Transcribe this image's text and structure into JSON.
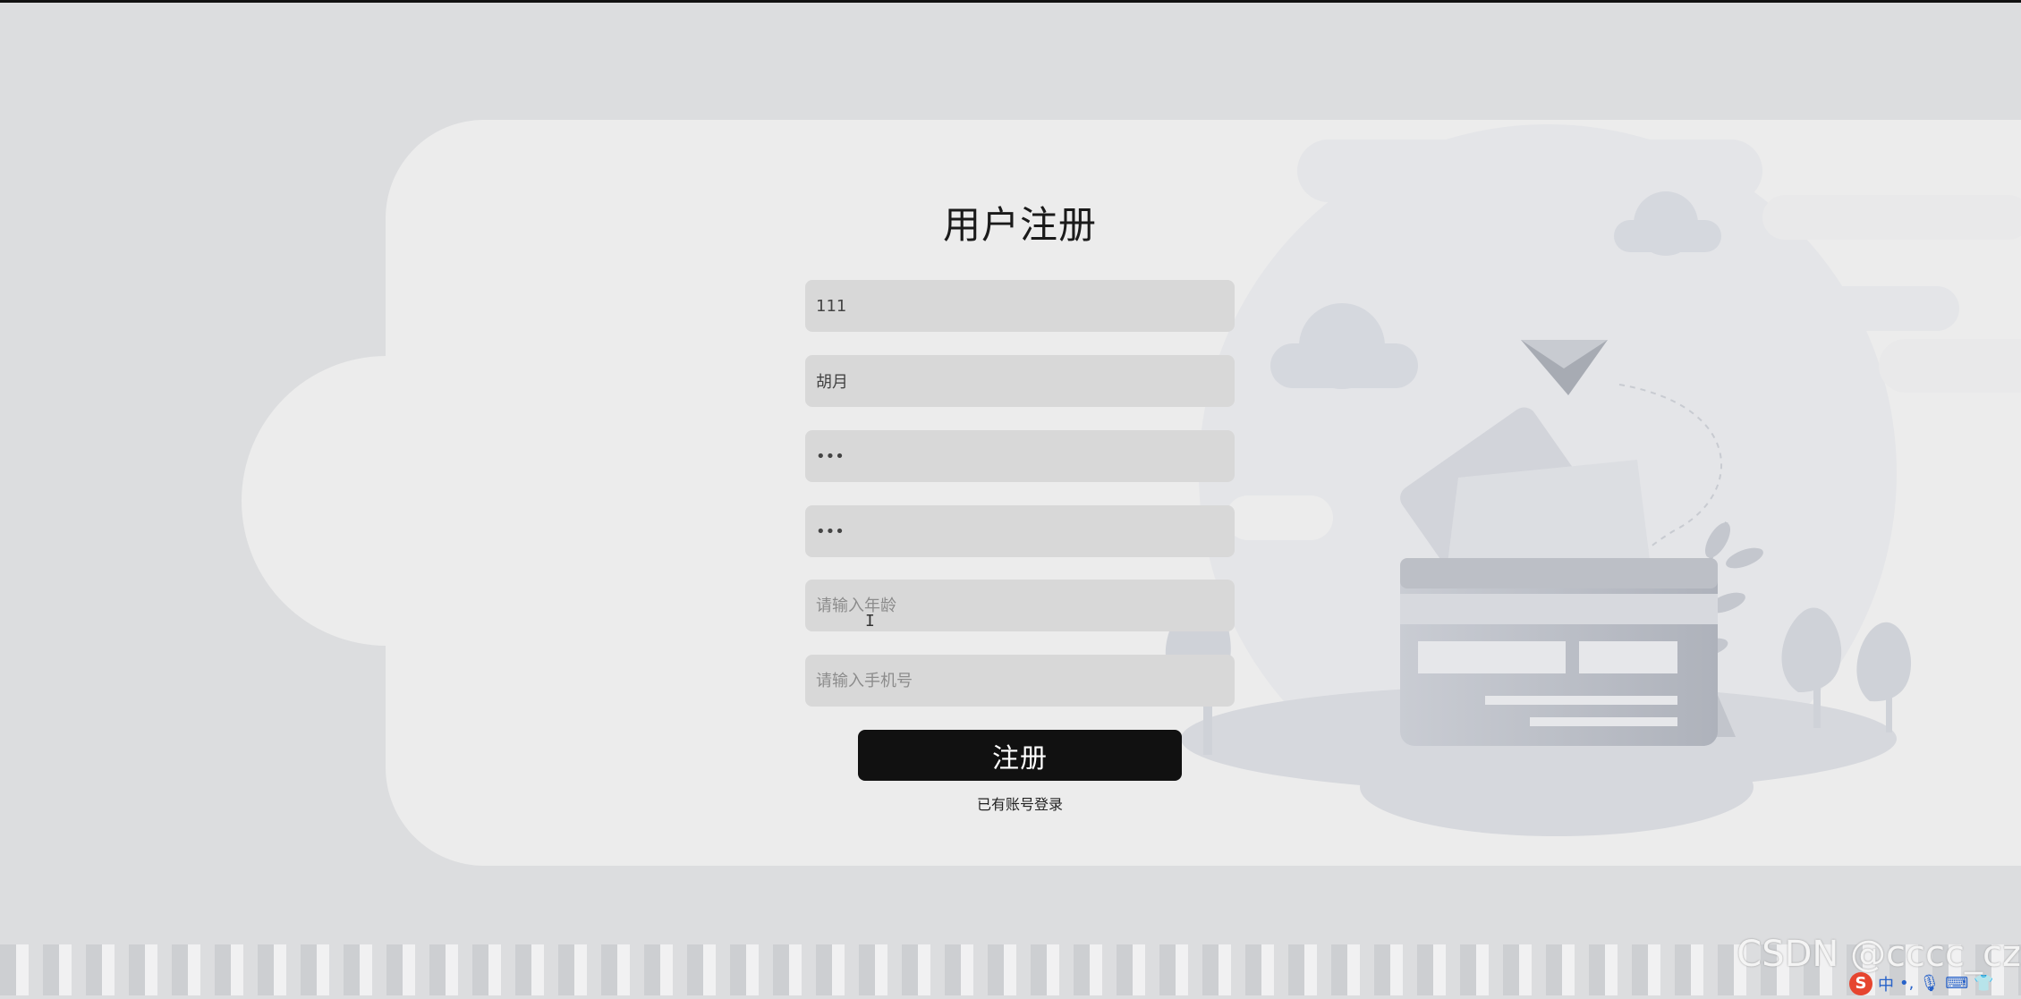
{
  "page": {
    "title": "用户注册"
  },
  "form": {
    "fields": [
      {
        "name": "username",
        "value": "111",
        "placeholder": "",
        "type": "text"
      },
      {
        "name": "realname",
        "value": "胡月",
        "placeholder": "",
        "type": "text"
      },
      {
        "name": "password",
        "value": "123",
        "placeholder": "",
        "type": "password"
      },
      {
        "name": "confirm_password",
        "value": "123",
        "placeholder": "",
        "type": "password"
      },
      {
        "name": "age",
        "value": "",
        "placeholder": "请输入年龄",
        "type": "text"
      },
      {
        "name": "phone",
        "value": "",
        "placeholder": "请输入手机号",
        "type": "text"
      }
    ],
    "submit_label": "注册",
    "login_link": "已有账号登录"
  },
  "overlay": {
    "watermark": "CSDN @cccc_cz",
    "ime_logo": "S",
    "ime_mode": "中"
  },
  "colors": {
    "background": "#dcdddf",
    "card": "#ececec",
    "input": "#d8d8d8",
    "button": "#111111",
    "button_text": "#ffffff"
  }
}
